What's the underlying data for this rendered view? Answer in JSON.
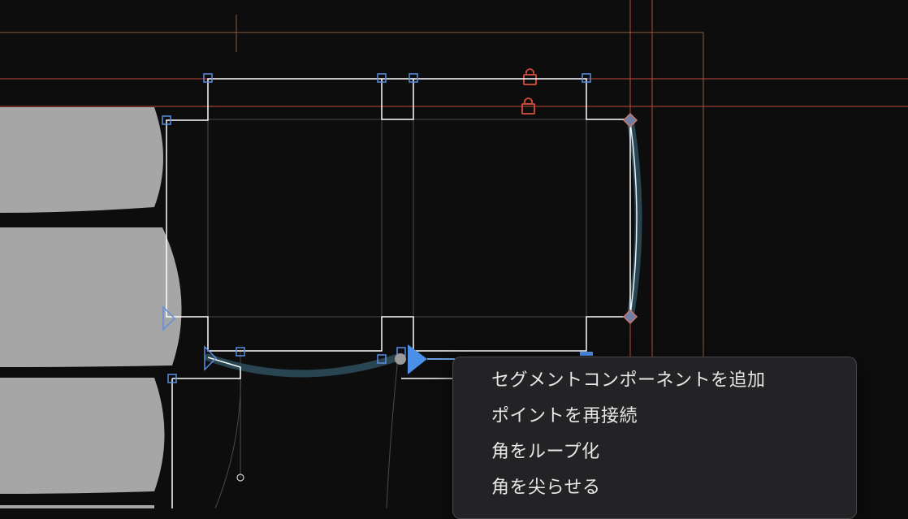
{
  "canvas": {
    "background": "#0d0d0e",
    "colors": {
      "guide": "#c0493b",
      "margin_guide": "#8a5a48",
      "outline": "#ffffff",
      "handle": "#5b8fe0",
      "highlight": "#2a4552",
      "glyph_fill": "#a6a6a6",
      "lock": "#c0493b"
    },
    "icons": [
      "lock-icon",
      "lock-icon",
      "start-point-triangle-icon",
      "point-direction-arrow-icon"
    ]
  },
  "context_menu": {
    "items": [
      {
        "label": "セグメントコンポーネントを追加"
      },
      {
        "label": "ポイントを再接続"
      },
      {
        "label": "角をループ化"
      },
      {
        "label": "角を尖らせる"
      }
    ]
  }
}
